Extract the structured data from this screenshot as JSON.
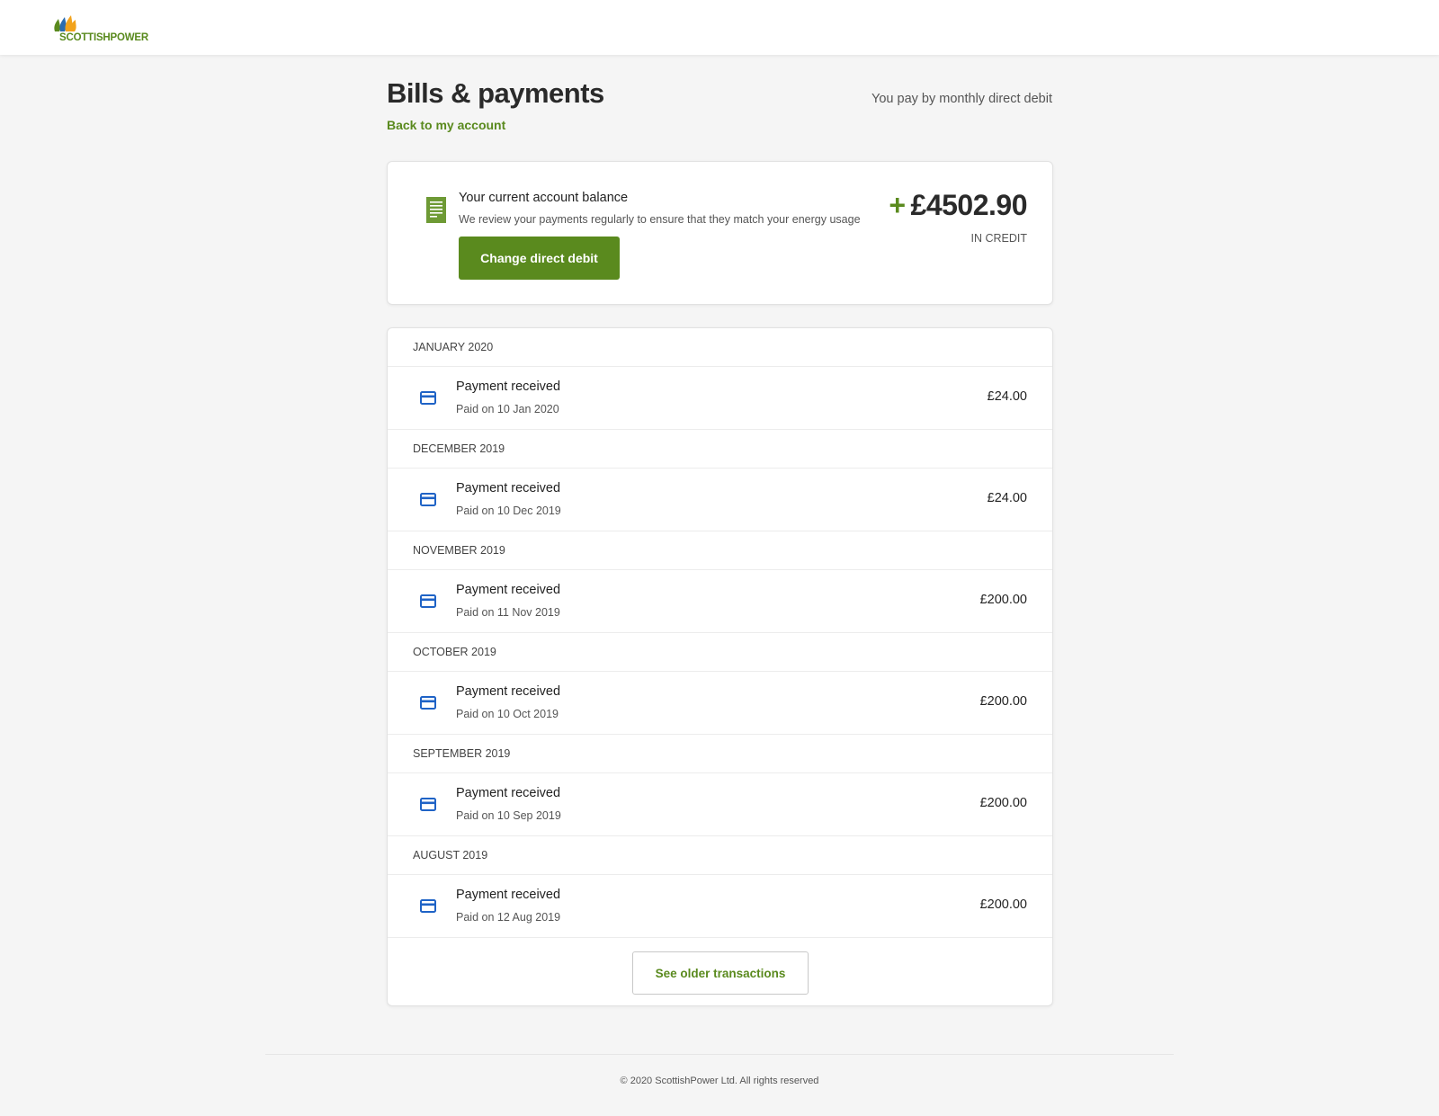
{
  "brand": {
    "logo_text": "SCOTTISHPOWER",
    "colors": {
      "green": "#5a8a1e",
      "orange": "#f2a31b",
      "blue": "#2b6cb0",
      "icon_blue": "#1f63c6"
    }
  },
  "header": {
    "title": "Bills & payments",
    "back_link": "Back to my account",
    "payment_method": "You pay by monthly direct debit"
  },
  "balance": {
    "title": "Your current account balance",
    "subtitle": "We review your payments regularly to ensure that they match your energy usage",
    "button_label": "Change direct debit",
    "sign": "+",
    "amount": "£4502.90",
    "status": "IN CREDIT",
    "icon": "document-icon"
  },
  "transactions": [
    {
      "month": "JANUARY 2020",
      "title": "Payment received",
      "date": "Paid on 10 Jan 2020",
      "amount": "£24.00",
      "icon": "card-icon"
    },
    {
      "month": "DECEMBER 2019",
      "title": "Payment received",
      "date": "Paid on 10 Dec 2019",
      "amount": "£24.00",
      "icon": "card-icon"
    },
    {
      "month": "NOVEMBER 2019",
      "title": "Payment received",
      "date": "Paid on 11 Nov 2019",
      "amount": "£200.00",
      "icon": "card-icon"
    },
    {
      "month": "OCTOBER 2019",
      "title": "Payment received",
      "date": "Paid on 10 Oct 2019",
      "amount": "£200.00",
      "icon": "card-icon"
    },
    {
      "month": "SEPTEMBER 2019",
      "title": "Payment received",
      "date": "Paid on 10 Sep 2019",
      "amount": "£200.00",
      "icon": "card-icon"
    },
    {
      "month": "AUGUST 2019",
      "title": "Payment received",
      "date": "Paid on 12 Aug 2019",
      "amount": "£200.00",
      "icon": "card-icon"
    }
  ],
  "older_button": "See older transactions",
  "footer": "© 2020 ScottishPower Ltd. All rights reserved"
}
